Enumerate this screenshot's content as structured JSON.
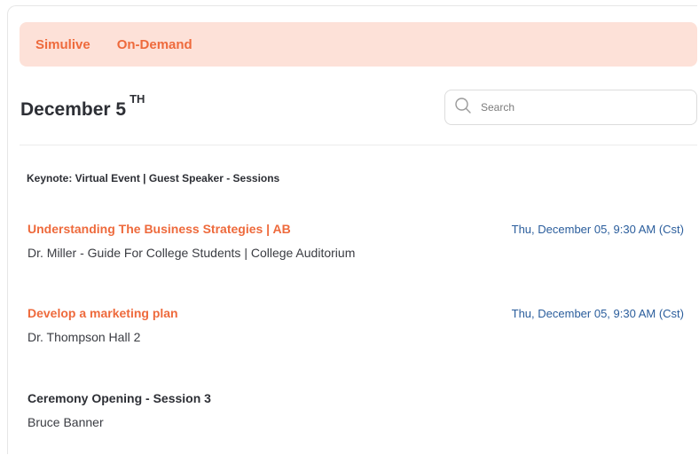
{
  "tabs": [
    {
      "label": "Simulive"
    },
    {
      "label": "On-Demand"
    }
  ],
  "date_heading": {
    "main": "December 5",
    "suffix": "TH"
  },
  "search": {
    "placeholder": "Search"
  },
  "section_title": "Keynote: Virtual Event | Guest Speaker - Sessions",
  "sessions": [
    {
      "title": "Understanding The Business Strategies | AB",
      "subtitle": "Dr. Miller - Guide For College Students | College Auditorium",
      "time": "Thu, December 05, 9:30 AM (Cst)"
    },
    {
      "title": "Develop a marketing plan",
      "subtitle": "Dr. Thompson Hall 2",
      "time": "Thu, December 05, 9:30 AM (Cst)"
    },
    {
      "title": "Ceremony Opening - Session 3",
      "subtitle": "Bruce Banner",
      "time": ""
    }
  ],
  "colors": {
    "accent": "#ee6a3c",
    "tab_background": "#fde1d8",
    "time_blue": "#2a5d9c",
    "heading": "#2d2f35"
  },
  "icons": {
    "search": "search-icon"
  }
}
